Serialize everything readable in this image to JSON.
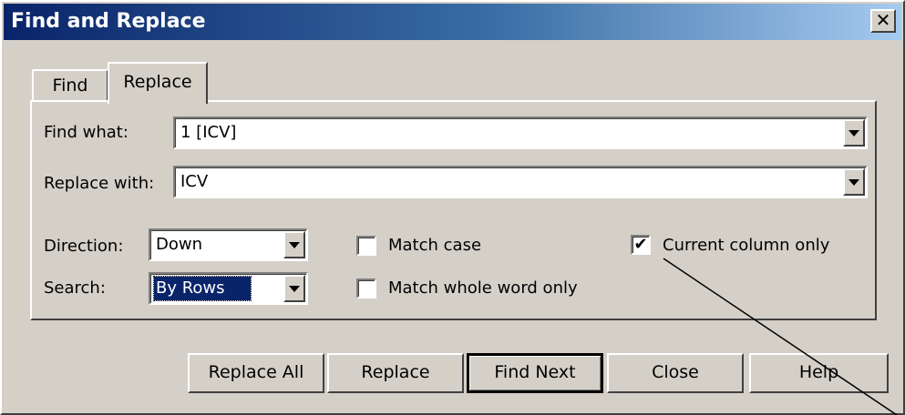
{
  "window": {
    "title": "Find and Replace",
    "close_glyph": "✕"
  },
  "tabs": [
    {
      "label": "Find",
      "active": false
    },
    {
      "label": "Replace",
      "active": true
    }
  ],
  "find_what": {
    "label": "Find what:",
    "value": "1 [ICV]"
  },
  "replace_with": {
    "label": "Replace with:",
    "value": "ICV"
  },
  "direction": {
    "label": "Direction:",
    "value": "Down"
  },
  "search": {
    "label": "Search:",
    "value": "By Rows"
  },
  "options": {
    "match_case": {
      "label": "Match case",
      "checked": false
    },
    "match_whole_word": {
      "label": "Match whole word only",
      "checked": false
    },
    "current_column": {
      "label": "Current column only",
      "checked": true,
      "mark": "✔"
    }
  },
  "buttons": {
    "replace_all": "Replace All",
    "replace": "Replace",
    "find_next": "Find Next",
    "close": "Close",
    "help": "Help"
  },
  "colors": {
    "title_start": "#0a246a",
    "title_end": "#a6caf0",
    "face": "#d4d0c8",
    "selection": "#0a246a"
  }
}
